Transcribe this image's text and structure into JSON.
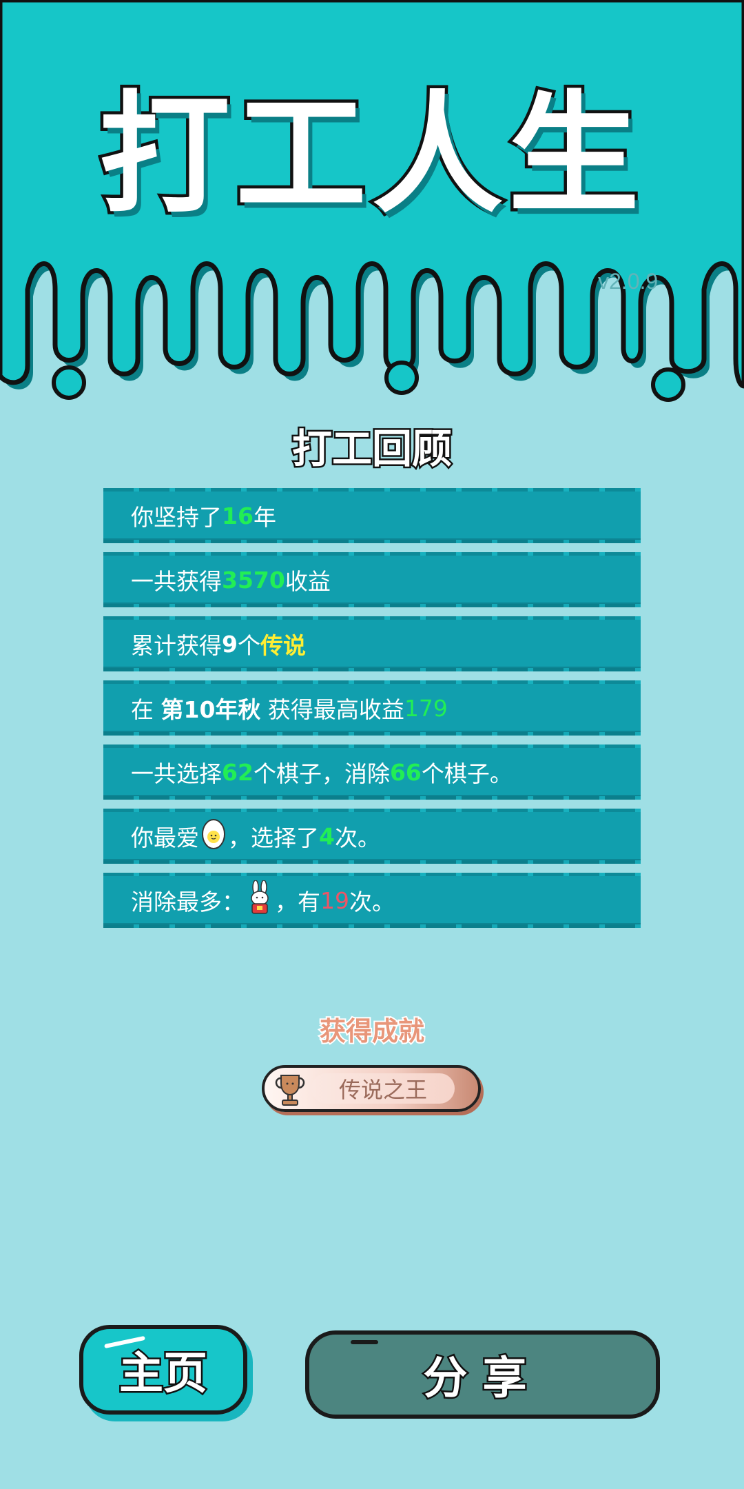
{
  "header": {
    "title": "打工人生",
    "version": "v2.0.9"
  },
  "review": {
    "title": "打工回顾",
    "rows": [
      {
        "prefix": "你坚持了",
        "value": "16",
        "suffix": "年"
      },
      {
        "prefix": "一共获得",
        "value": "3570",
        "suffix": "收益"
      },
      {
        "prefix": "累计获得",
        "value": "9",
        "middle": "个",
        "highlight": "传说"
      },
      {
        "prefix": "在 ",
        "bold": "第10年秋",
        "middle": " 获得最高收益",
        "value": "179"
      },
      {
        "prefix": "一共选择",
        "value": "62",
        "middle": "个棋子，消除",
        "value2": "66",
        "suffix": "个棋子。"
      },
      {
        "prefix": "你最爱",
        "icon": "egg-icon",
        "middle": "，选择了",
        "value": "4",
        "suffix": "次。"
      },
      {
        "prefix": "消除最多：",
        "icon": "rabbit-icon",
        "middle": "，有",
        "value": "19",
        "suffix": "次。"
      }
    ]
  },
  "achievement": {
    "title": "获得成就",
    "badge_label": "传说之王",
    "icon": "trophy-icon"
  },
  "buttons": {
    "home": "主页",
    "share": "分享"
  },
  "colors": {
    "background": "#9fdfe5",
    "header": "#16c6c8",
    "row": "#119fae",
    "value_green": "#22ee55",
    "value_yellow": "#ffee33",
    "value_red": "#ee5566"
  }
}
